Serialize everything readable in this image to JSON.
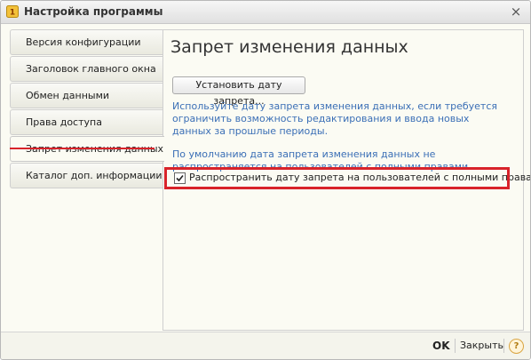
{
  "window": {
    "title": "Настройка программы",
    "close_glyph": "×"
  },
  "sidebar": {
    "items": [
      {
        "label": "Версия конфигурации"
      },
      {
        "label": "Заголовок главного окна"
      },
      {
        "label": "Обмен данными"
      },
      {
        "label": "Права доступа"
      },
      {
        "label": "Запрет изменения данных",
        "active": true
      },
      {
        "label": "Каталог доп. информации"
      }
    ]
  },
  "panel": {
    "heading": "Запрет изменения данных",
    "set_date_button": "Установить дату запрета...",
    "hint1": "Используйте дату запрета изменения данных, если требуется ограничить возможность редактирования и ввода новых данных за прошлые периоды.",
    "hint2": "По умолчанию дата запрета изменения данных не распространяется на пользователей с полными правами",
    "checkbox_label": "Распространить дату запрета на пользователей с полными правами",
    "checkbox_checked": true
  },
  "footer": {
    "ok": "OK",
    "close": "Закрыть",
    "help_glyph": "?"
  },
  "colors": {
    "accent_red": "#d8232a",
    "hint_blue": "#3b6fb6"
  }
}
